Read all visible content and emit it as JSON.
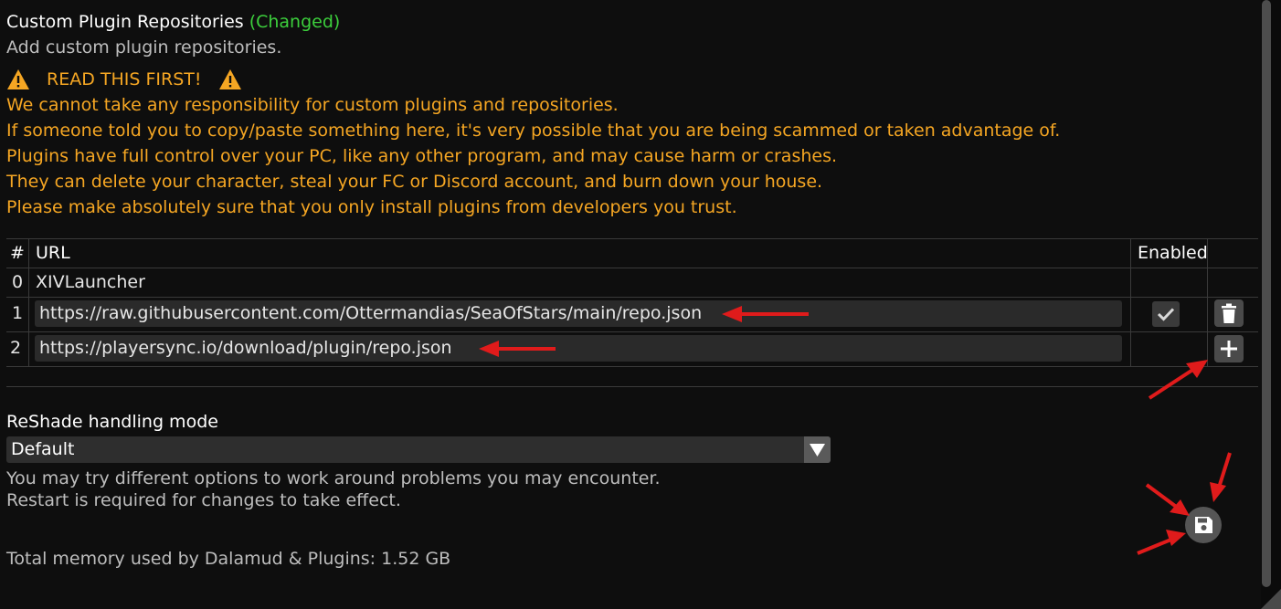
{
  "repos_section": {
    "title": "Custom Plugin Repositories",
    "changed_tag": "(Changed)",
    "subtitle": "Add custom plugin repositories."
  },
  "warning": {
    "heading": "READ THIS FIRST!",
    "icon": "warning-icon",
    "lines": [
      "We cannot take any responsibility for custom plugins and repositories.",
      "If someone told you to copy/paste something here, it's very possible that you are being scammed or taken advantage of.",
      "Plugins have full control over your PC, like any other program, and may cause harm or crashes.",
      "They can delete your character, steal your FC or Discord account, and burn down your house.",
      "Please make absolutely sure that you only install plugins from developers you trust."
    ]
  },
  "repo_table": {
    "headers": {
      "index": "#",
      "url": "URL",
      "enabled": "Enabled"
    },
    "rows": [
      {
        "index": "0",
        "url": "XIVLauncher"
      },
      {
        "index": "1",
        "url": "https://raw.githubusercontent.com/Ottermandias/SeaOfStars/main/repo.json",
        "enabled": true
      },
      {
        "index": "2",
        "url": "https://playersync.io/download/plugin/repo.json"
      }
    ]
  },
  "reshade": {
    "label": "ReShade handling mode",
    "selected": "Default",
    "hint_lines": [
      "You may try different options to work around problems you may encounter.",
      "Restart is required for changes to take effect."
    ]
  },
  "memory": {
    "text": "Total memory used by Dalamud & Plugins: 1.52 GB"
  },
  "colors": {
    "accent_changed": "#3ccf3c",
    "warning": "#f5a623",
    "annotation_arrow": "#e01b1b"
  }
}
